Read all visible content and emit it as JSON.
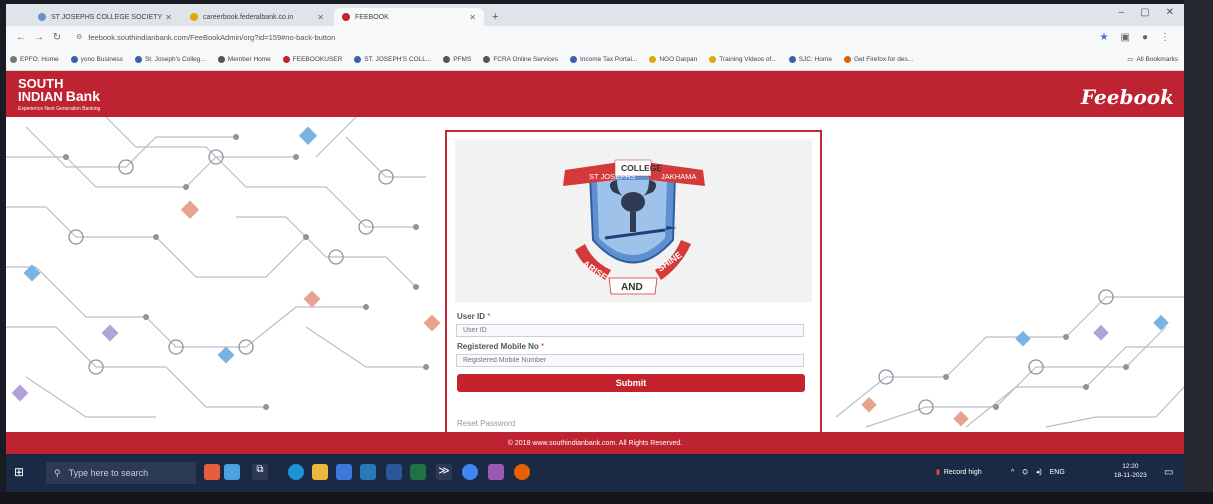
{
  "browser": {
    "tabs": [
      {
        "label": "ST JOSEPHS COLLEGE SOCIETY",
        "color": "#6c8fce"
      },
      {
        "label": "careerbook.federalbank.co.in",
        "color": "#e0a800"
      },
      {
        "label": "FEEBOOK",
        "color": "#c4232e"
      }
    ],
    "new_tab": "+",
    "url": "feebook.southindianbank.com/FeeBookAdmin/org?id=159#no-back-button",
    "bookmarks": [
      {
        "label": "EPFO: Home",
        "color": "#777777"
      },
      {
        "label": "yono Business",
        "color": "#3b5fa8"
      },
      {
        "label": "St. Joseph's Colleg...",
        "color": "#3b5fa8"
      },
      {
        "label": "Member Home",
        "color": "#555555"
      },
      {
        "label": "FEEBOOKUSER",
        "color": "#c4232e"
      },
      {
        "label": "ST. JOSEPH'S COLL...",
        "color": "#3b5fa8"
      },
      {
        "label": "PFMS",
        "color": "#555555"
      },
      {
        "label": "FCRA Online Services",
        "color": "#555555"
      },
      {
        "label": "Income Tax Portal...",
        "color": "#3b5fa8"
      },
      {
        "label": "NGO Darpan",
        "color": "#e0a800"
      },
      {
        "label": "Training Videos of...",
        "color": "#e0a800"
      },
      {
        "label": "SJC: Home",
        "color": "#3b5fa8"
      },
      {
        "label": "Get Firefox for des...",
        "color": "#e66000"
      }
    ],
    "all_bookmarks": "All Bookmarks"
  },
  "header": {
    "bank_line1": "SOUTH",
    "bank_line2": "INDIAN",
    "bank_word": "Bank",
    "tagline": "Experience Next Generation Banking",
    "brand": "Feebook"
  },
  "logo": {
    "top_left": "ST JOSEPHS",
    "top_mid": "COLLEGE",
    "top_right": "JAKHAMA",
    "motto_1": "ARISE",
    "motto_2": "AND",
    "motto_3": "SHINE"
  },
  "form": {
    "user_id_label": "User ID",
    "user_id_placeholder": "User ID",
    "mobile_label": "Registered Mobile No",
    "mobile_placeholder": "Registered Mobile Number",
    "required_mark": "*",
    "submit": "Submit",
    "reset": "Reset Password"
  },
  "footer": {
    "text": "© 2018 www.southindianbank.com. All Rights Reserved."
  },
  "taskbar": {
    "search_placeholder": "Type here to search",
    "record": "Record high",
    "lang": "ENG",
    "time": "12:20",
    "date": "18-11-2023"
  },
  "colors": {
    "brand_red": "#bd2331",
    "button_red": "#c4232e",
    "taskbar": "#1b2a44"
  }
}
